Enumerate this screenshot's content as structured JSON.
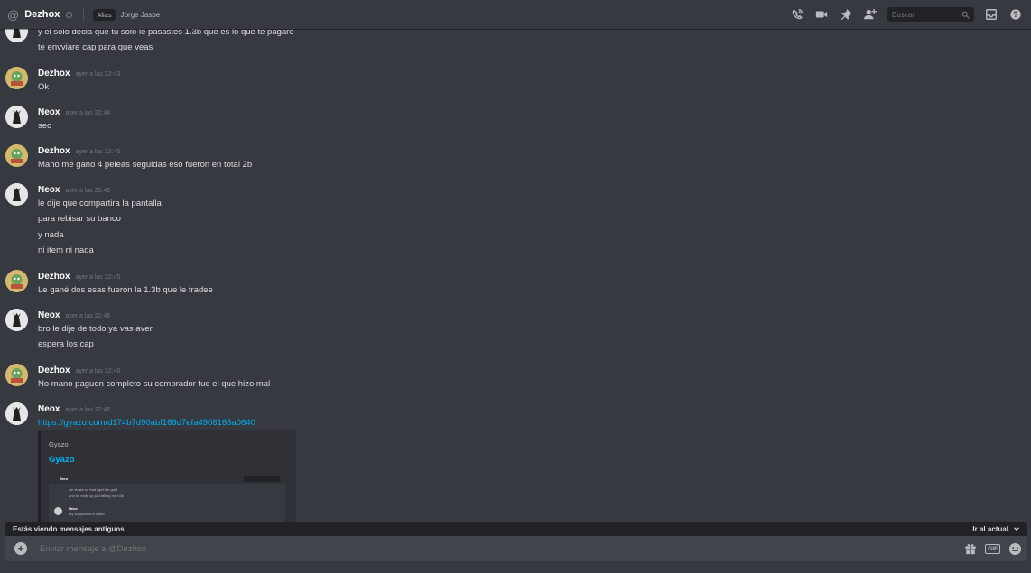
{
  "header": {
    "dm_name": "Dezhox",
    "alias_tag": "Alias",
    "alias_name": "Jorge Jaspe",
    "search_placeholder": "Buscar",
    "icons": [
      "at-icon",
      "voice-call-icon",
      "video-call-icon",
      "pin-icon",
      "add-friend-icon",
      "search-icon",
      "inbox-icon",
      "help-icon"
    ]
  },
  "messages": [
    {
      "lines": [
        "y el solo decia que tu solo le pasastes 1.3b que es lo que te pagare",
        "te envviare cap para que veas"
      ]
    },
    {
      "author": "Dezhox",
      "timestamp": "ayer a las 22:43",
      "lines": [
        "Ok"
      ]
    },
    {
      "author": "Neox",
      "timestamp": "ayer a las 22:44",
      "lines": [
        "sec"
      ]
    },
    {
      "author": "Dezhox",
      "timestamp": "ayer a las 22:45",
      "lines": [
        "Mano me gano 4 peleas seguidas eso fueron en total 2b"
      ]
    },
    {
      "author": "Neox",
      "timestamp": "ayer a las 22:45",
      "lines": [
        "le dije que compartira la pantalla",
        "para rebisar su banco",
        "y nada",
        "ni item ni nada"
      ]
    },
    {
      "author": "Dezhox",
      "timestamp": "ayer a las 22:45",
      "lines": [
        "Le gané dos esas fueron la 1.3b que le tradee"
      ]
    },
    {
      "author": "Neox",
      "timestamp": "ayer a las 22:46",
      "lines": [
        "bro le dije de todo ya vas aver",
        "espera los cap"
      ]
    },
    {
      "author": "Dezhox",
      "timestamp": "ayer a las 22:46",
      "lines": [
        "No mano paguen completo su comprador fue el que hizo mal"
      ]
    },
    {
      "author": "Neox",
      "timestamp": "ayer a las 22:46",
      "link": "https://gyazo.com/d174b7d90abf169d7efa4908168a0640"
    }
  ],
  "embed": {
    "provider": "Gyazo",
    "title": "Gyazo",
    "thumb_name": "Bero",
    "thumb_lines": [
      "we shake so that i get the gold",
      "and he ends up just telling me h3b"
    ],
    "thumb_author": "Neox",
    "thumb_reply": "my suspicions a dumb"
  },
  "old_messages_bar": {
    "text": "Estás viendo mensajes antiguos",
    "jump_label": "Ir al actual"
  },
  "composer": {
    "placeholder": "Enviar mensaje a @Dezhox",
    "gif_label": "GIF"
  }
}
